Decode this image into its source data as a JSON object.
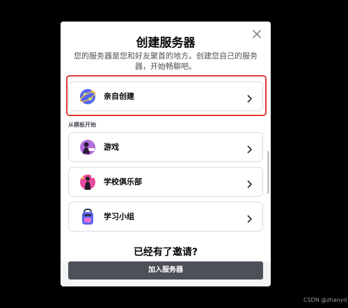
{
  "dialog": {
    "title": "创建服务器",
    "subtitle": "您的服务器是您和好友聚首的地方。创建您自己的服务器，开始畅聊吧。",
    "close_icon": "close-icon"
  },
  "options": [
    {
      "label": "亲自创建",
      "icon": "globe-icon"
    },
    {
      "label": "游戏",
      "icon": "game-icon"
    },
    {
      "label": "学校俱乐部",
      "icon": "school-club-icon"
    },
    {
      "label": "学习小组",
      "icon": "backpack-icon"
    }
  ],
  "templates_section_label": "从模板开始",
  "footer": {
    "title": "已经有了邀请?",
    "join_button": "加入服务器"
  },
  "watermark": "CSDN @zhanyd",
  "colors": {
    "background": "#000000",
    "highlight_border": "#e03a3a",
    "join_button": "#4e5058"
  }
}
